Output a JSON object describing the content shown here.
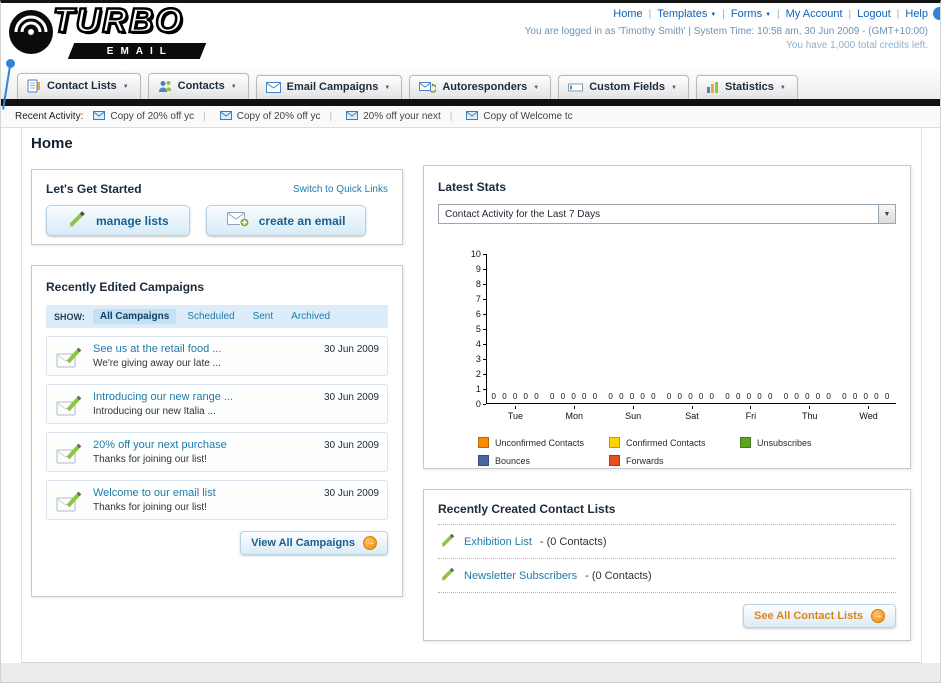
{
  "header": {
    "logo": {
      "title": "TURBO",
      "subtitle": "EMAIL"
    },
    "nav": [
      "Home",
      "Templates",
      "Forms",
      "My Account",
      "Logout",
      "Help"
    ],
    "status_line": "You are logged in as 'Timothy Smith' | System Time: 10:58 am, 30 Jun 2009 - (GMT+10:00)",
    "credits_line": "You have 1,000 total credits left."
  },
  "tabs": [
    "Contact Lists",
    "Contacts",
    "Email Campaigns",
    "Autoresponders",
    "Custom Fields",
    "Statistics"
  ],
  "recent_activity": {
    "label": "Recent Activity:",
    "items": [
      "Copy of 20% off yc",
      "Copy of 20% off yc",
      "20% off your next",
      "Copy of Welcome tc"
    ]
  },
  "page": {
    "title": "Home"
  },
  "get_started": {
    "title": "Let's Get Started",
    "switch_link": "Switch to Quick Links",
    "manage_button": "manage lists",
    "create_button": "create an email"
  },
  "campaigns": {
    "title": "Recently Edited Campaigns",
    "show_label": "SHOW:",
    "filters": [
      "All Campaigns",
      "Scheduled",
      "Sent",
      "Archived"
    ],
    "active_filter": "All Campaigns",
    "items": [
      {
        "title": "See us at the retail food ...",
        "subtitle": "We're giving away our late ...",
        "date": "30 Jun 2009"
      },
      {
        "title": "Introducing our new range ...",
        "subtitle": "Introducing our new Italia ...",
        "date": "30 Jun 2009"
      },
      {
        "title": "20% off your next purchase",
        "subtitle": "Thanks for joining our list!",
        "date": "30 Jun 2009"
      },
      {
        "title": "Welcome to our email list",
        "subtitle": "Thanks for joining our list!",
        "date": "30 Jun 2009"
      }
    ],
    "view_all": "View All Campaigns"
  },
  "latest_stats": {
    "title": "Latest Stats",
    "range_selector": "Contact Activity for the Last 7 Days",
    "chart_data": {
      "type": "bar",
      "title": "Contact Activity for the Last 7 Days",
      "categories": [
        "Tue",
        "Mon",
        "Sun",
        "Sat",
        "Fri",
        "Thu",
        "Wed"
      ],
      "series": [
        {
          "name": "Unconfirmed Contacts",
          "values": [
            0,
            0,
            0,
            0,
            0,
            0,
            0
          ]
        },
        {
          "name": "Confirmed Contacts",
          "values": [
            0,
            0,
            0,
            0,
            0,
            0,
            0
          ]
        },
        {
          "name": "Unsubscribes",
          "values": [
            0,
            0,
            0,
            0,
            0,
            0,
            0
          ]
        },
        {
          "name": "Bounces",
          "values": [
            0,
            0,
            0,
            0,
            0,
            0,
            0
          ]
        },
        {
          "name": "Forwards",
          "values": [
            0,
            0,
            0,
            0,
            0,
            0,
            0
          ]
        }
      ],
      "ylim": [
        0,
        10
      ],
      "ytick_step": 1,
      "grid": false,
      "legend_position": "bottom"
    },
    "legend": [
      {
        "label": "Unconfirmed Contacts",
        "color": "#fe8a00"
      },
      {
        "label": "Confirmed Contacts",
        "color": "#ffd200"
      },
      {
        "label": "Unsubscribes",
        "color": "#5ca621"
      },
      {
        "label": "Bounces",
        "color": "#4a66a0"
      },
      {
        "label": "Forwards",
        "color": "#e84e1c"
      }
    ]
  },
  "contact_lists": {
    "title": "Recently Created Contact Lists",
    "items": [
      {
        "name": "Exhibition List",
        "detail": "- (0 Contacts)"
      },
      {
        "name": "Newsletter Subscribers",
        "detail": "- (0 Contacts)"
      }
    ],
    "see_all": "See All Contact Lists"
  },
  "colors": {
    "link_teal": "#1e7ba8",
    "nav_blue": "#0d62b8",
    "button_text_blue": "#1a6091",
    "button_text_amber": "#d9861c",
    "divider_black": "#121212"
  }
}
